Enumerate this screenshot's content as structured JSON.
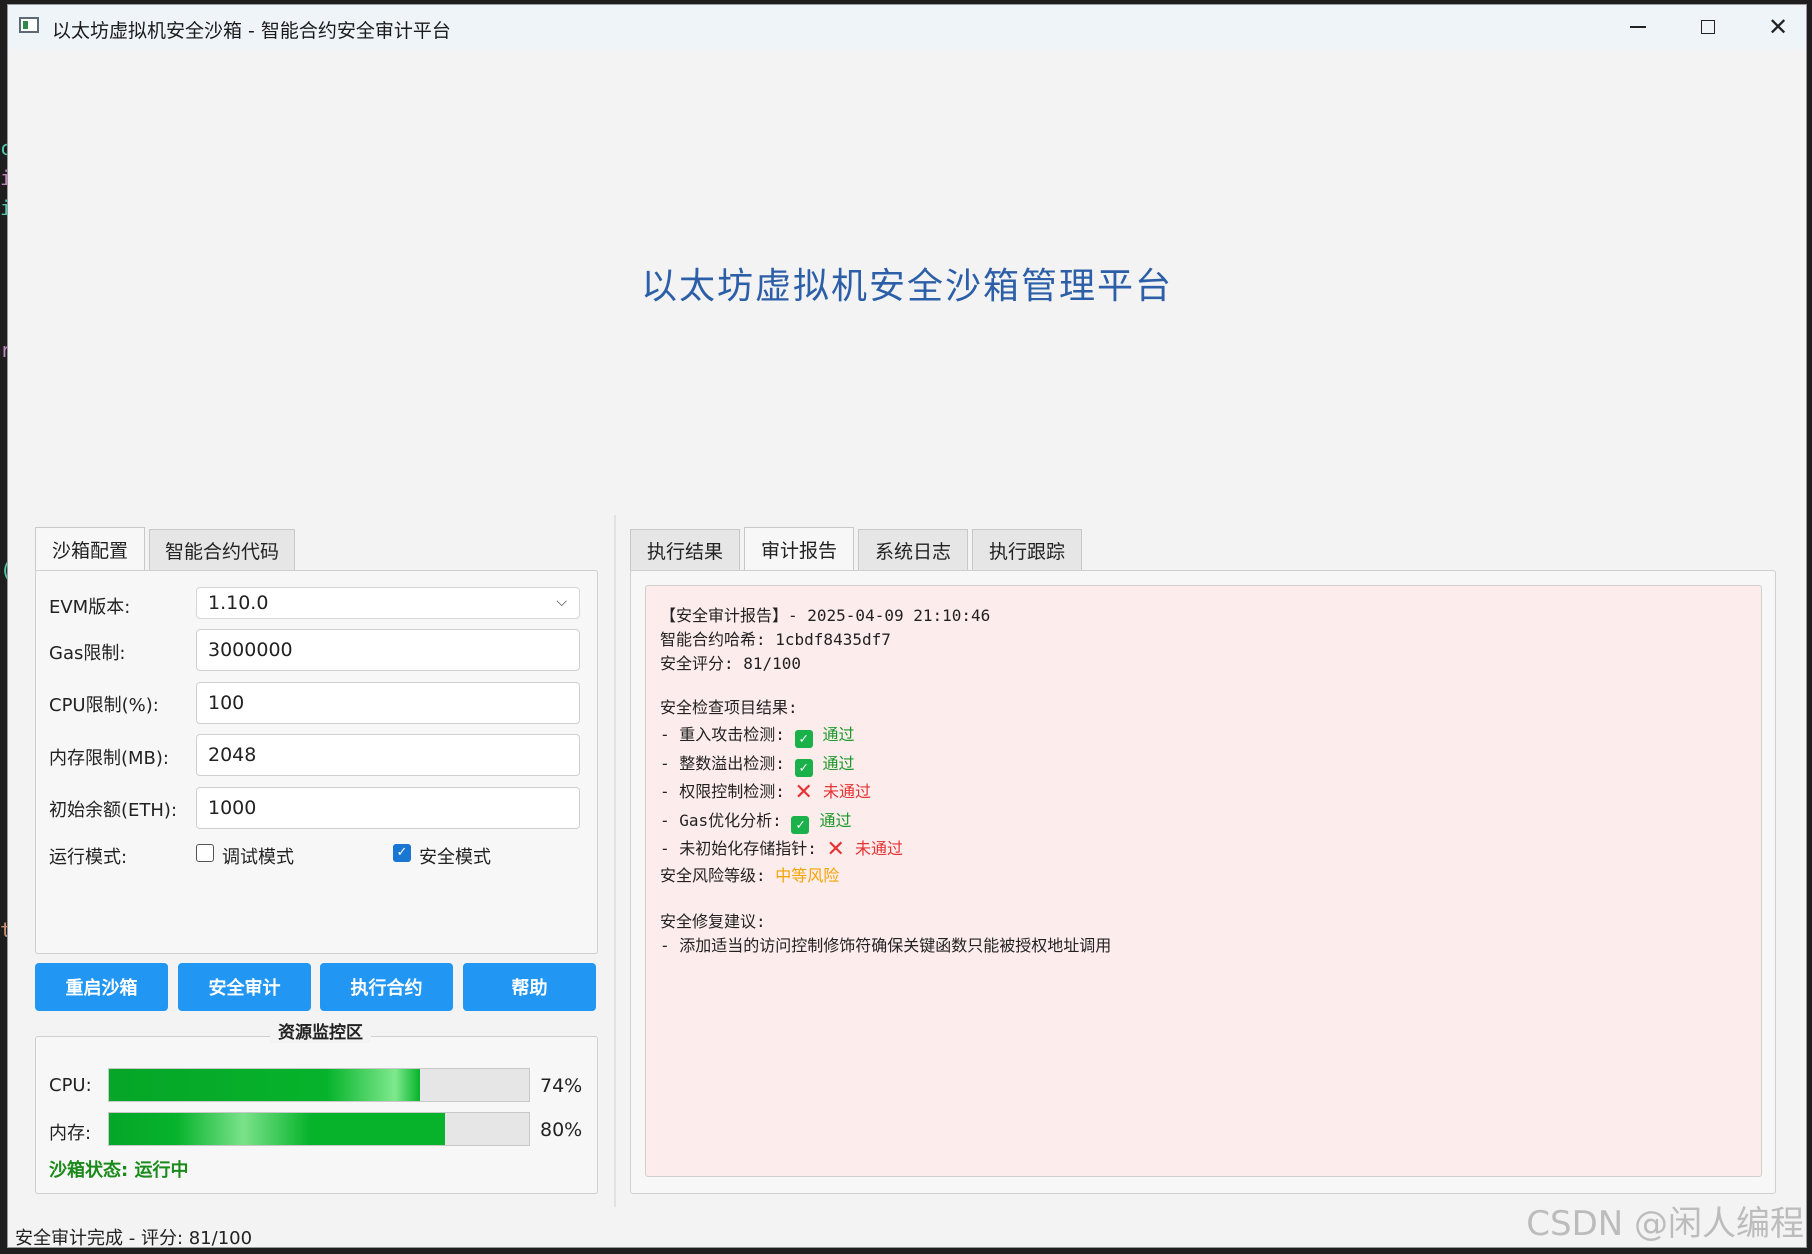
{
  "window": {
    "title": "以太坊虚拟机安全沙箱 - 智能合约安全审计平台"
  },
  "header": {
    "title": "以太坊虚拟机安全沙箱管理平台"
  },
  "left_tabs": [
    "沙箱配置",
    "智能合约代码"
  ],
  "config": {
    "evm_label": "EVM版本:",
    "evm_value": "1.10.0",
    "gas_label": "Gas限制:",
    "gas_value": "3000000",
    "cpu_label": "CPU限制(%):",
    "cpu_value": "100",
    "mem_label": "内存限制(MB):",
    "mem_value": "2048",
    "balance_label": "初始余额(ETH):",
    "balance_value": "1000",
    "mode_label": "运行模式:",
    "debug_mode": {
      "label": "调试模式",
      "checked": false
    },
    "safe_mode": {
      "label": "安全模式",
      "checked": true
    }
  },
  "actions": {
    "restart": "重启沙箱",
    "audit": "安全审计",
    "execute": "执行合约",
    "help": "帮助"
  },
  "monitor": {
    "title": "资源监控区",
    "cpu_label": "CPU:",
    "cpu_percent": 74,
    "cpu_text": "74%",
    "mem_label": "内存:",
    "mem_percent": 80,
    "mem_text": "80%",
    "status": "沙箱状态: 运行中"
  },
  "right_tabs": [
    "执行结果",
    "审计报告",
    "系统日志",
    "执行跟踪"
  ],
  "report": {
    "header_line": "【安全审计报告】- 2025-04-09 21:10:46",
    "hash_line": "智能合约哈希: 1cbdf8435df7",
    "score_line": "安全评分: 81/100",
    "checks_title": "安全检查项目结果:",
    "checks": [
      {
        "name": "- 重入攻击检测: ",
        "result": "通过",
        "pass": true
      },
      {
        "name": "- 整数溢出检测: ",
        "result": "通过",
        "pass": true
      },
      {
        "name": "- 权限控制检测: ",
        "result": "未通过",
        "pass": false
      },
      {
        "name": "- Gas优化分析: ",
        "result": "通过",
        "pass": true
      },
      {
        "name": "- 未初始化存储指针: ",
        "result": "未通过",
        "pass": false
      }
    ],
    "risk_label": "安全风险等级: ",
    "risk_value": "中等风险",
    "fix_title": "安全修复建议:",
    "fix_line": "- 添加适当的访问控制修饰符确保关键函数只能被授权地址调用"
  },
  "status_bar": "安全审计完成 - 评分: 81/100",
  "watermark": "CSDN @闲人编程",
  "colors": {
    "accent": "#2196f3",
    "heading": "#2c5fa8",
    "pass": "#1a9a2a",
    "fail": "#e63232",
    "risk": "#f5a400",
    "report_bg": "#fdecec"
  }
}
